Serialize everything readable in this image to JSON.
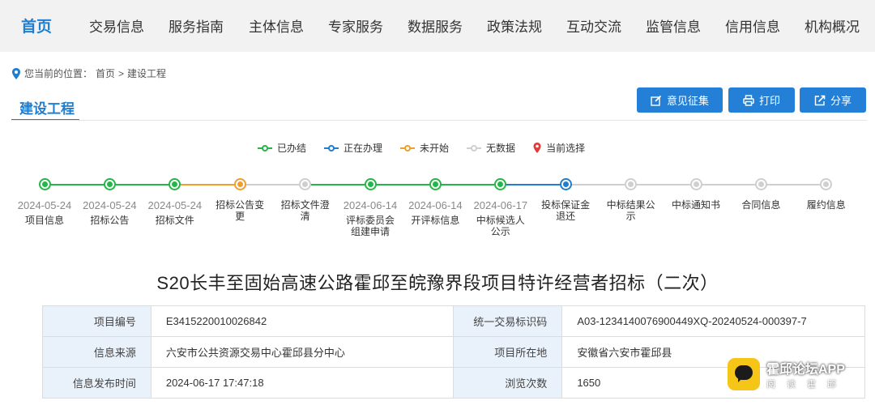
{
  "nav": {
    "home": "首页",
    "items": [
      "交易信息",
      "服务指南",
      "主体信息",
      "专家服务",
      "数据服务",
      "政策法规",
      "互动交流",
      "监管信息",
      "信用信息",
      "机构概况"
    ]
  },
  "breadcrumb": {
    "prefix": "您当前的位置：",
    "home": "首页",
    "sep": ">",
    "current": "建设工程"
  },
  "section_tab": "建设工程",
  "buttons": {
    "feedback": "意见征集",
    "print": "打印",
    "share": "分享"
  },
  "legend": {
    "done": "已办结",
    "in_progress": "正在办理",
    "not_started": "未开始",
    "no_data": "无数据",
    "current": "当前选择"
  },
  "colors": {
    "done": "#27b54a",
    "in_progress": "#1f7ed0",
    "not_started": "#f0a02a",
    "no_data": "#cfcfcf",
    "current": "#e23b3b",
    "accent": "#1f7ed0"
  },
  "timeline": [
    {
      "date": "2024-05-24",
      "label": "项目信息",
      "status": "done"
    },
    {
      "date": "2024-05-24",
      "label": "招标公告",
      "status": "done"
    },
    {
      "date": "2024-05-24",
      "label": "招标文件",
      "status": "done"
    },
    {
      "date": "",
      "label": "招标公告变更",
      "status": "not_started"
    },
    {
      "date": "",
      "label": "招标文件澄清",
      "status": "no_data"
    },
    {
      "date": "2024-06-14",
      "label": "评标委员会组建申请",
      "status": "done"
    },
    {
      "date": "2024-06-14",
      "label": "开评标信息",
      "status": "done"
    },
    {
      "date": "2024-06-17",
      "label": "中标候选人公示",
      "status": "done"
    },
    {
      "date": "",
      "label": "投标保证金退还",
      "status": "in_progress"
    },
    {
      "date": "",
      "label": "中标结果公示",
      "status": "no_data"
    },
    {
      "date": "",
      "label": "中标通知书",
      "status": "no_data"
    },
    {
      "date": "",
      "label": "合同信息",
      "status": "no_data"
    },
    {
      "date": "",
      "label": "履约信息",
      "status": "no_data"
    }
  ],
  "title": "S20长丰至固始高速公路霍邱至皖豫界段项目特许经营者招标（二次）",
  "info": {
    "project_no_label": "项目编号",
    "project_no": "E3415220010026842",
    "trade_code_label": "统一交易标识码",
    "trade_code": "A03-1234140076900449XQ-20240524-000397-7",
    "source_label": "信息来源",
    "source": "六安市公共资源交易中心霍邱县分中心",
    "location_label": "项目所在地",
    "location": "安徽省六安市霍邱县",
    "publish_time_label": "信息发布时间",
    "publish_time": "2024-06-17 17:47:18",
    "views_label": "浏览次数",
    "views": "1650"
  },
  "watermark": {
    "title": "霍邱论坛APP",
    "subtitle": "阅读霍邱"
  }
}
